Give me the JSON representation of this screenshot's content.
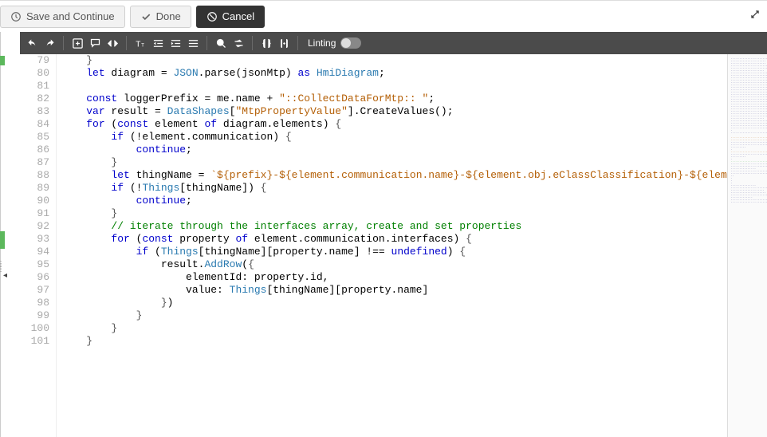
{
  "topbar": {
    "save_label": "Save and Continue",
    "done_label": "Done",
    "cancel_label": "Cancel"
  },
  "toolbar": {
    "linting_label": "Linting",
    "linting_enabled": false
  },
  "code": {
    "first_line": 79,
    "lines": [
      [
        {
          "t": "}",
          "c": "br",
          "i": 0
        }
      ],
      [
        {
          "t": "let",
          "c": "kw",
          "i": 0
        },
        {
          "t": " diagram = ",
          "c": ""
        },
        {
          "t": "JSON",
          "c": "id"
        },
        {
          "t": ".parse(jsonMtp) ",
          "c": ""
        },
        {
          "t": "as",
          "c": "kw"
        },
        {
          "t": " ",
          "c": ""
        },
        {
          "t": "HmiDiagram",
          "c": "id"
        },
        {
          "t": ";",
          "c": ""
        }
      ],
      [
        {
          "t": "",
          "c": ""
        }
      ],
      [
        {
          "t": "const",
          "c": "kw",
          "i": 0
        },
        {
          "t": " loggerPrefix = me.name + ",
          "c": ""
        },
        {
          "t": "\"::CollectDataForMtp:: \"",
          "c": "str"
        },
        {
          "t": ";",
          "c": ""
        }
      ],
      [
        {
          "t": "var",
          "c": "kw",
          "i": 0
        },
        {
          "t": " result = ",
          "c": ""
        },
        {
          "t": "DataShapes",
          "c": "id"
        },
        {
          "t": "[",
          "c": ""
        },
        {
          "t": "\"MtpPropertyValue\"",
          "c": "str"
        },
        {
          "t": "].CreateValues();",
          "c": ""
        }
      ],
      [
        {
          "t": "for",
          "c": "kw",
          "i": 0
        },
        {
          "t": " (",
          "c": ""
        },
        {
          "t": "const",
          "c": "kw"
        },
        {
          "t": " element ",
          "c": ""
        },
        {
          "t": "of",
          "c": "kw"
        },
        {
          "t": " diagram.elements) ",
          "c": ""
        },
        {
          "t": "{",
          "c": "br"
        }
      ],
      [
        {
          "t": "if",
          "c": "kw",
          "i": 1
        },
        {
          "t": " (!element.communication) ",
          "c": ""
        },
        {
          "t": "{",
          "c": "br"
        }
      ],
      [
        {
          "t": "continue",
          "c": "kw",
          "i": 2
        },
        {
          "t": ";",
          "c": ""
        }
      ],
      [
        {
          "t": "}",
          "c": "br",
          "i": 1
        }
      ],
      [
        {
          "t": "let",
          "c": "kw",
          "i": 1
        },
        {
          "t": " thingName = ",
          "c": ""
        },
        {
          "t": "`${prefix}-${element.communication.name}-${element.obj.eClassClassification}-${elem",
          "c": "str"
        }
      ],
      [
        {
          "t": "if",
          "c": "kw",
          "i": 1
        },
        {
          "t": " (!",
          "c": ""
        },
        {
          "t": "Things",
          "c": "id"
        },
        {
          "t": "[thingName]) ",
          "c": ""
        },
        {
          "t": "{",
          "c": "br"
        }
      ],
      [
        {
          "t": "continue",
          "c": "kw",
          "i": 2
        },
        {
          "t": ";",
          "c": ""
        }
      ],
      [
        {
          "t": "}",
          "c": "br",
          "i": 1
        }
      ],
      [
        {
          "t": "// iterate through the interfaces array, create and set properties",
          "c": "cmt",
          "i": 1
        }
      ],
      [
        {
          "t": "for",
          "c": "kw",
          "i": 1
        },
        {
          "t": " (",
          "c": ""
        },
        {
          "t": "const",
          "c": "kw"
        },
        {
          "t": " property ",
          "c": ""
        },
        {
          "t": "of",
          "c": "kw"
        },
        {
          "t": " element.communication.interfaces) ",
          "c": ""
        },
        {
          "t": "{",
          "c": "br"
        }
      ],
      [
        {
          "t": "if",
          "c": "kw",
          "i": 2
        },
        {
          "t": " (",
          "c": ""
        },
        {
          "t": "Things",
          "c": "id"
        },
        {
          "t": "[thingName][property.name] ",
          "c": ""
        },
        {
          "t": "!==",
          "c": ""
        },
        {
          "t": " ",
          "c": ""
        },
        {
          "t": "undefined",
          "c": "kw"
        },
        {
          "t": ") ",
          "c": ""
        },
        {
          "t": "{",
          "c": "br"
        }
      ],
      [
        {
          "t": "result.",
          "c": "",
          "i": 3
        },
        {
          "t": "AddRow",
          "c": "id"
        },
        {
          "t": "(",
          "c": ""
        },
        {
          "t": "{",
          "c": "br"
        }
      ],
      [
        {
          "t": "elementId: property.id,",
          "c": "",
          "i": 4
        }
      ],
      [
        {
          "t": "value: ",
          "c": "",
          "i": 4
        },
        {
          "t": "Things",
          "c": "id"
        },
        {
          "t": "[thingName][property.name]",
          "c": ""
        }
      ],
      [
        {
          "t": "}",
          "c": "br",
          "i": 3
        },
        {
          "t": ")",
          "c": ""
        }
      ],
      [
        {
          "t": "}",
          "c": "br",
          "i": 2
        }
      ],
      [
        {
          "t": "}",
          "c": "br",
          "i": 1
        }
      ],
      [
        {
          "t": "}",
          "c": "br",
          "i": 0
        }
      ]
    ]
  }
}
